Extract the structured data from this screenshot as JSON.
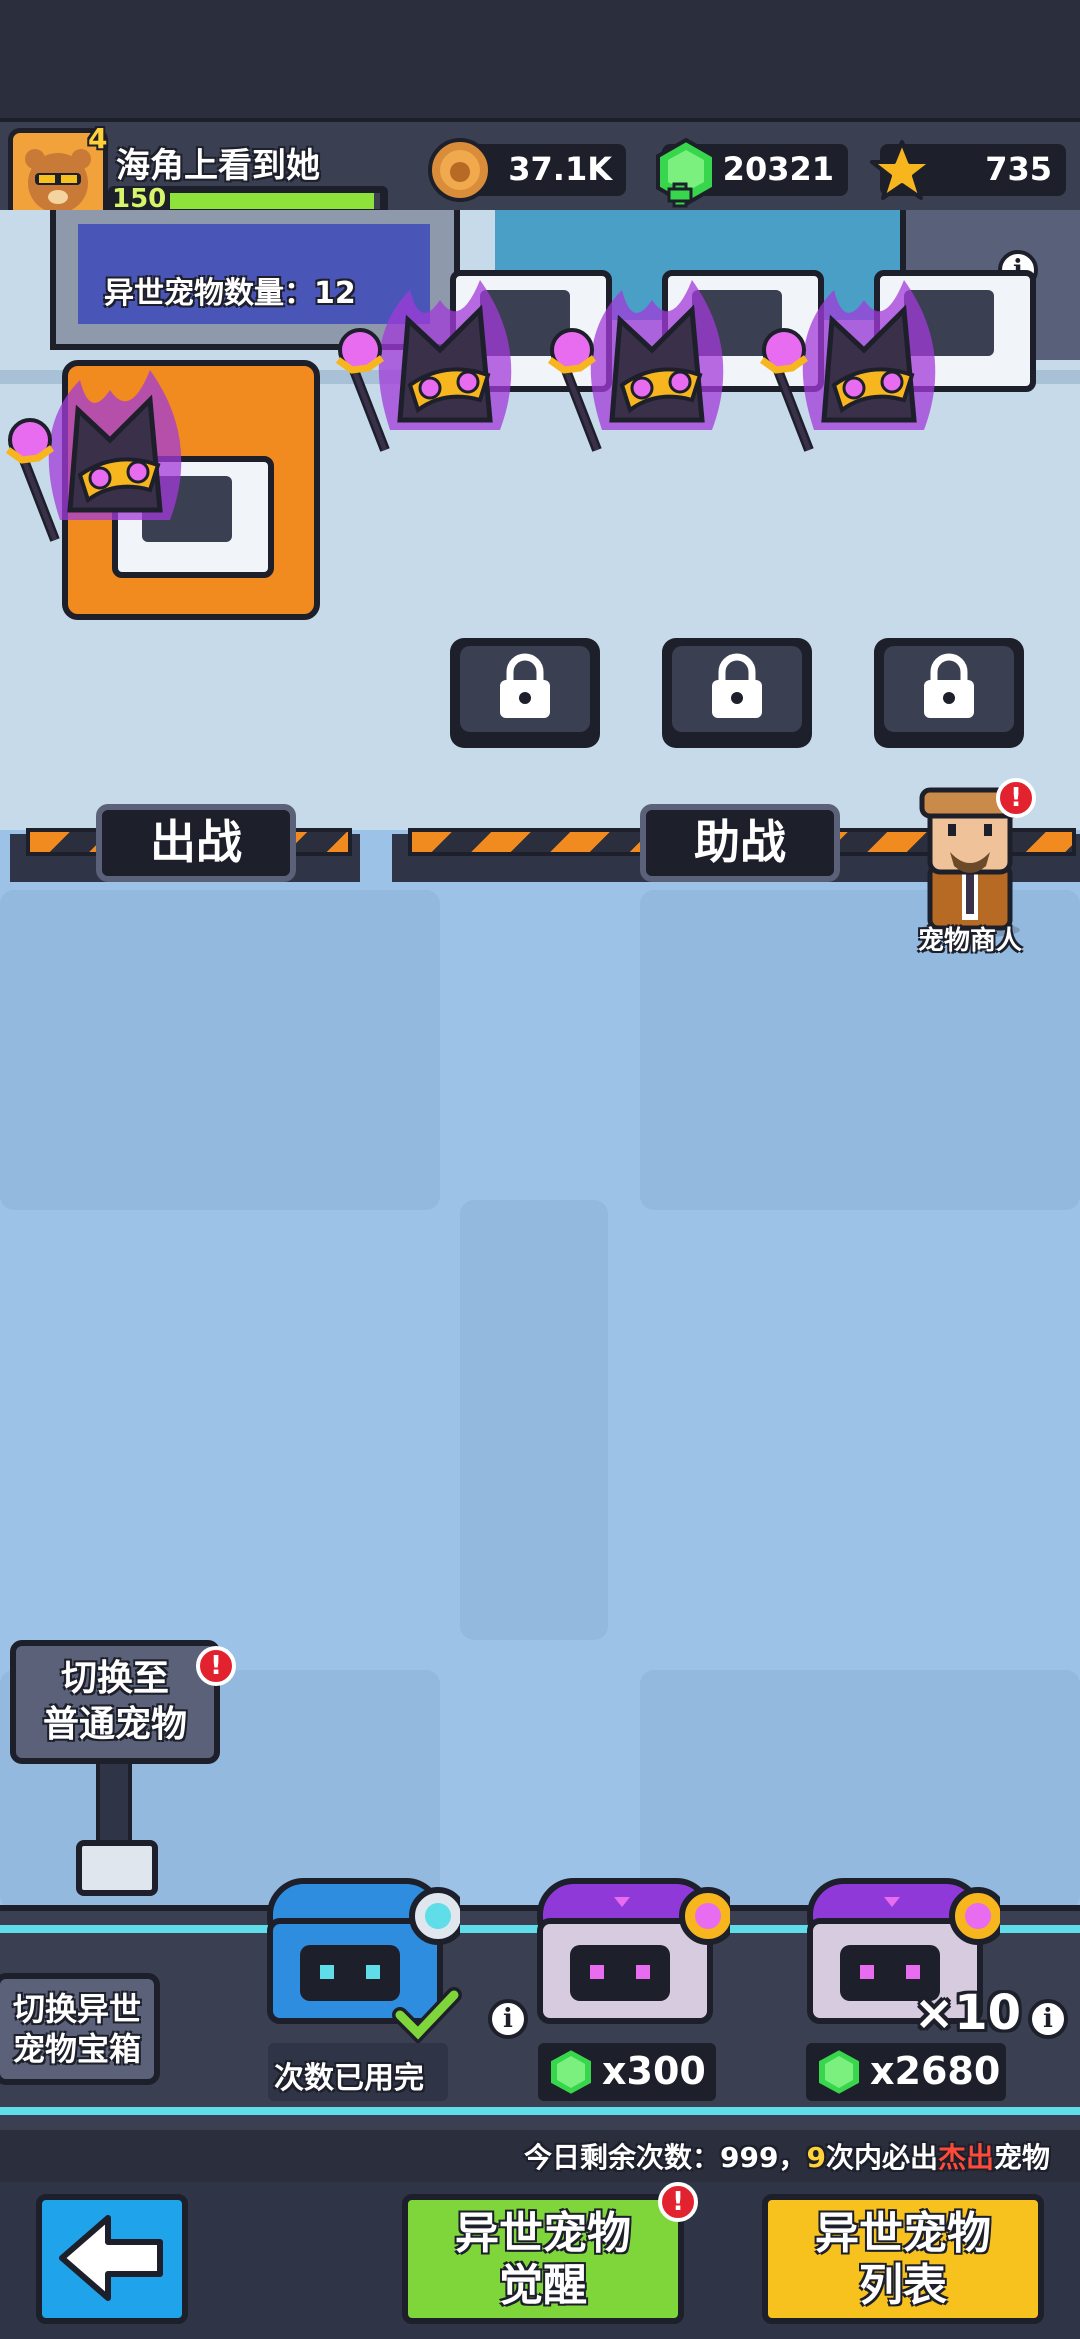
{
  "player": {
    "name": "海角上看到她",
    "level": "150",
    "vip": "4",
    "exp_fraction": 0.97
  },
  "currencies": {
    "coins": "37.1K",
    "gems": "20321",
    "stars": "735"
  },
  "pet_count_label": "异世宠物数量：12",
  "slots": {
    "battle_label": "出战",
    "assist_label": "助战"
  },
  "merchant": {
    "label": "宠物商人",
    "badge": "!"
  },
  "switch_sign": {
    "line1": "切换至",
    "line2": "普通宠物",
    "badge": "!"
  },
  "chests": {
    "switch_label_line1": "切换异世",
    "switch_label_line2": "宠物宝箱",
    "free_status": "次数已用完",
    "single_price": "x300",
    "ten_count": "×10",
    "ten_price": "x2680",
    "info_icon": "i"
  },
  "daily_info": {
    "prefix": "今日剩余次数：999，",
    "count": "9",
    "middle": "次内必出",
    "highlight": "杰出",
    "suffix": "宠物"
  },
  "nav": {
    "back_icon": "arrow-left-icon",
    "awaken_line1": "异世宠物",
    "awaken_line2": "觉醒",
    "awaken_badge": "!",
    "list_line1": "异世宠物",
    "list_line2": "列表"
  },
  "colors": {
    "gem_green": "#37d64c",
    "awaken_button": "#7fd63a",
    "list_button": "#f7c21e",
    "back_button": "#1fa3ea",
    "highlight_red": "#ff4a3a",
    "count_yellow": "#ffd23a"
  }
}
